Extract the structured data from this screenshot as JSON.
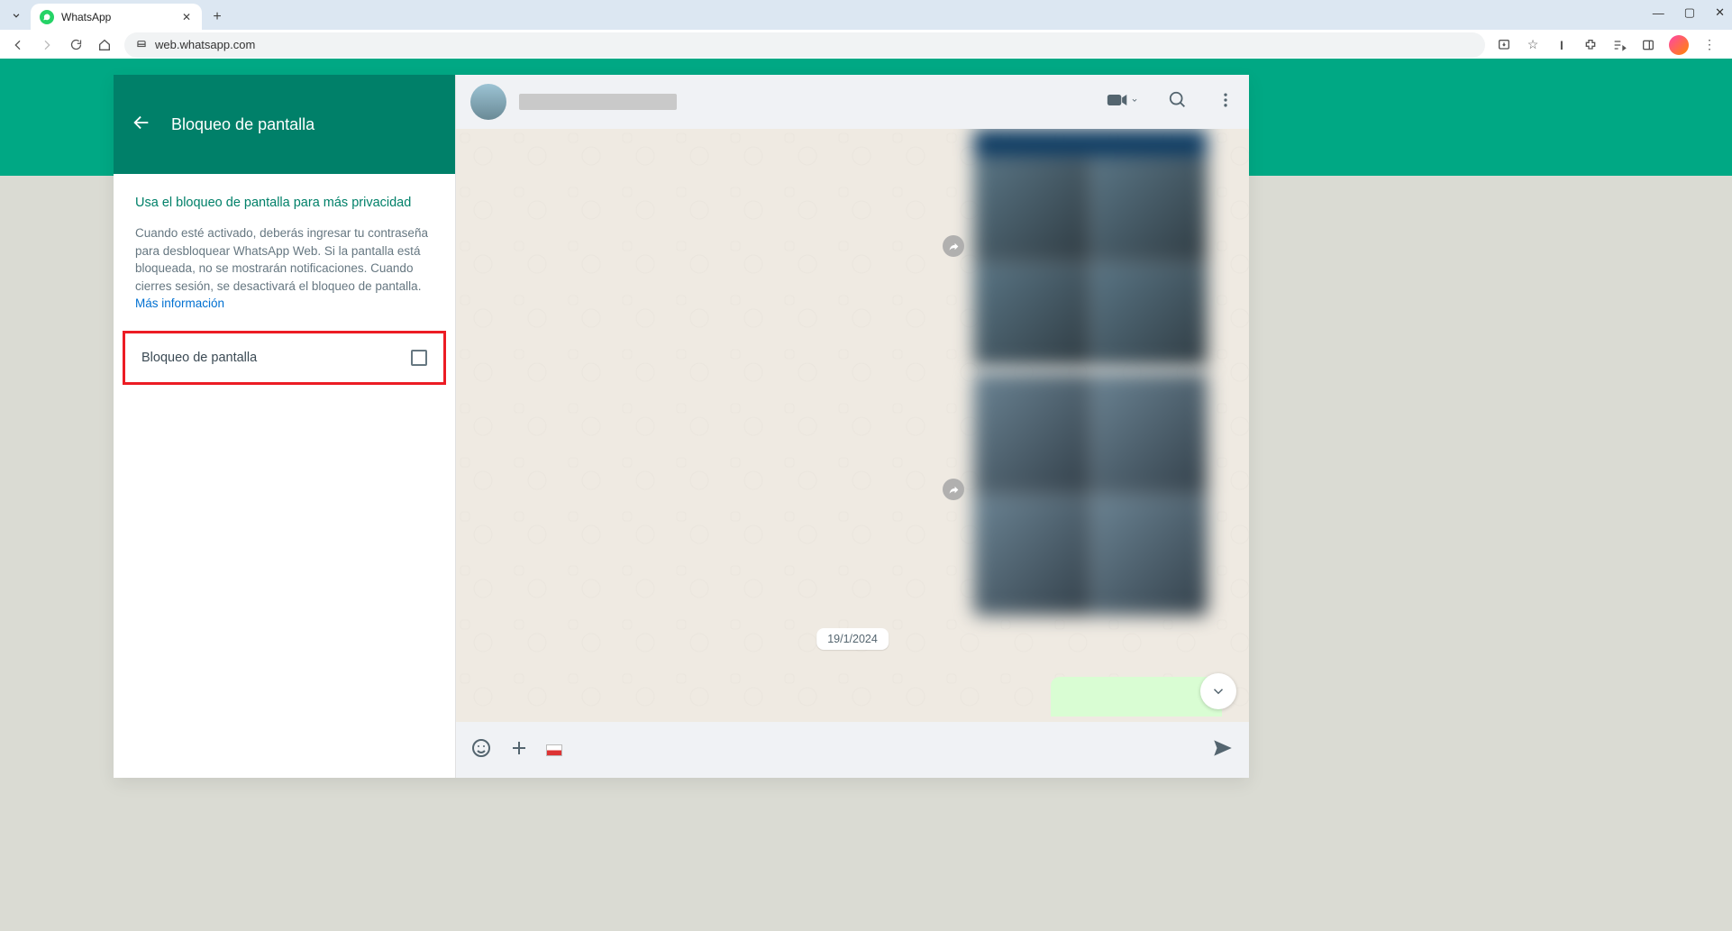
{
  "browser": {
    "tab_title": "WhatsApp",
    "url": "web.whatsapp.com"
  },
  "sidebar": {
    "title": "Bloqueo de pantalla",
    "heading": "Usa el bloqueo de pantalla para más privacidad",
    "description": "Cuando esté activado, deberás ingresar tu contraseña para desbloquear WhatsApp Web. Si la pantalla está bloqueada, no se mostrarán notificaciones. Cuando cierres sesión, se desactivará el bloqueo de pantalla. ",
    "more_info": "Más información",
    "option_label": "Bloqueo de pantalla",
    "option_checked": false
  },
  "chat": {
    "date_separator": "19/1/2024"
  }
}
